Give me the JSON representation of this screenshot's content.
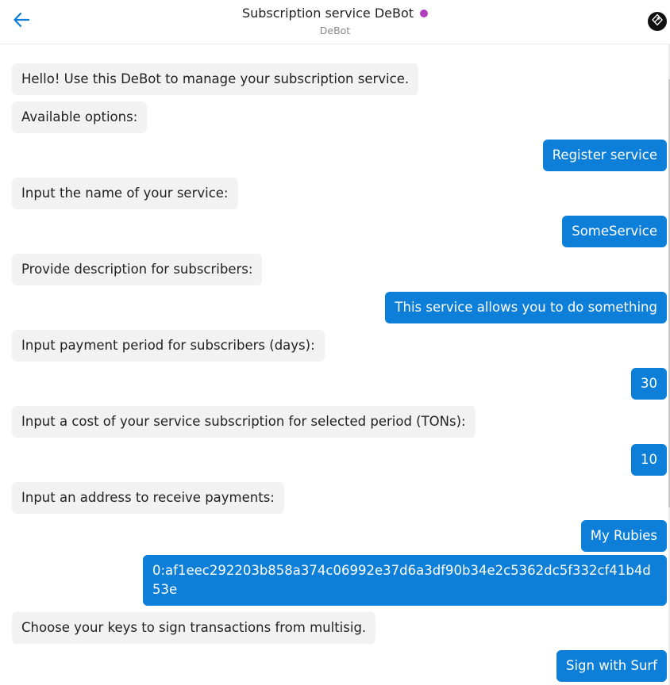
{
  "header": {
    "title": "Subscription service DeBot",
    "subtitle": "DeBot",
    "status_color": "#b13ebf",
    "back_icon": "arrow-left-icon",
    "avatar_icon": "surf-logo-icon"
  },
  "colors": {
    "accent": "#0d7fd9",
    "bot_bubble": "#f2f2f2"
  },
  "messages": [
    {
      "from": "bot",
      "text": "Hello! Use this DeBot to manage your subscription service."
    },
    {
      "from": "bot",
      "text": "Available options:"
    },
    {
      "from": "user",
      "text": "Register service"
    },
    {
      "from": "bot",
      "text": "Input the name of your service:"
    },
    {
      "from": "user",
      "text": "SomeService"
    },
    {
      "from": "bot",
      "text": "Provide description for subscribers:"
    },
    {
      "from": "user",
      "text": "This service allows you to do something"
    },
    {
      "from": "bot",
      "text": "Input payment period for subscribers (days):"
    },
    {
      "from": "user",
      "text": "30"
    },
    {
      "from": "bot",
      "text": "Input a cost of your service subscription for selected period (TONs):"
    },
    {
      "from": "user",
      "text": "10"
    },
    {
      "from": "bot",
      "text": "Input an address to receive payments:"
    },
    {
      "from": "user",
      "text": "My Rubies"
    },
    {
      "from": "user",
      "text": "0:af1eec292203b858a374c06992e37d6a3df90b34e2c5362dc5f332cf41b4d53e"
    },
    {
      "from": "bot",
      "text": "Choose your keys to sign transactions from multisig."
    },
    {
      "from": "user",
      "text": "Sign with Surf"
    }
  ]
}
